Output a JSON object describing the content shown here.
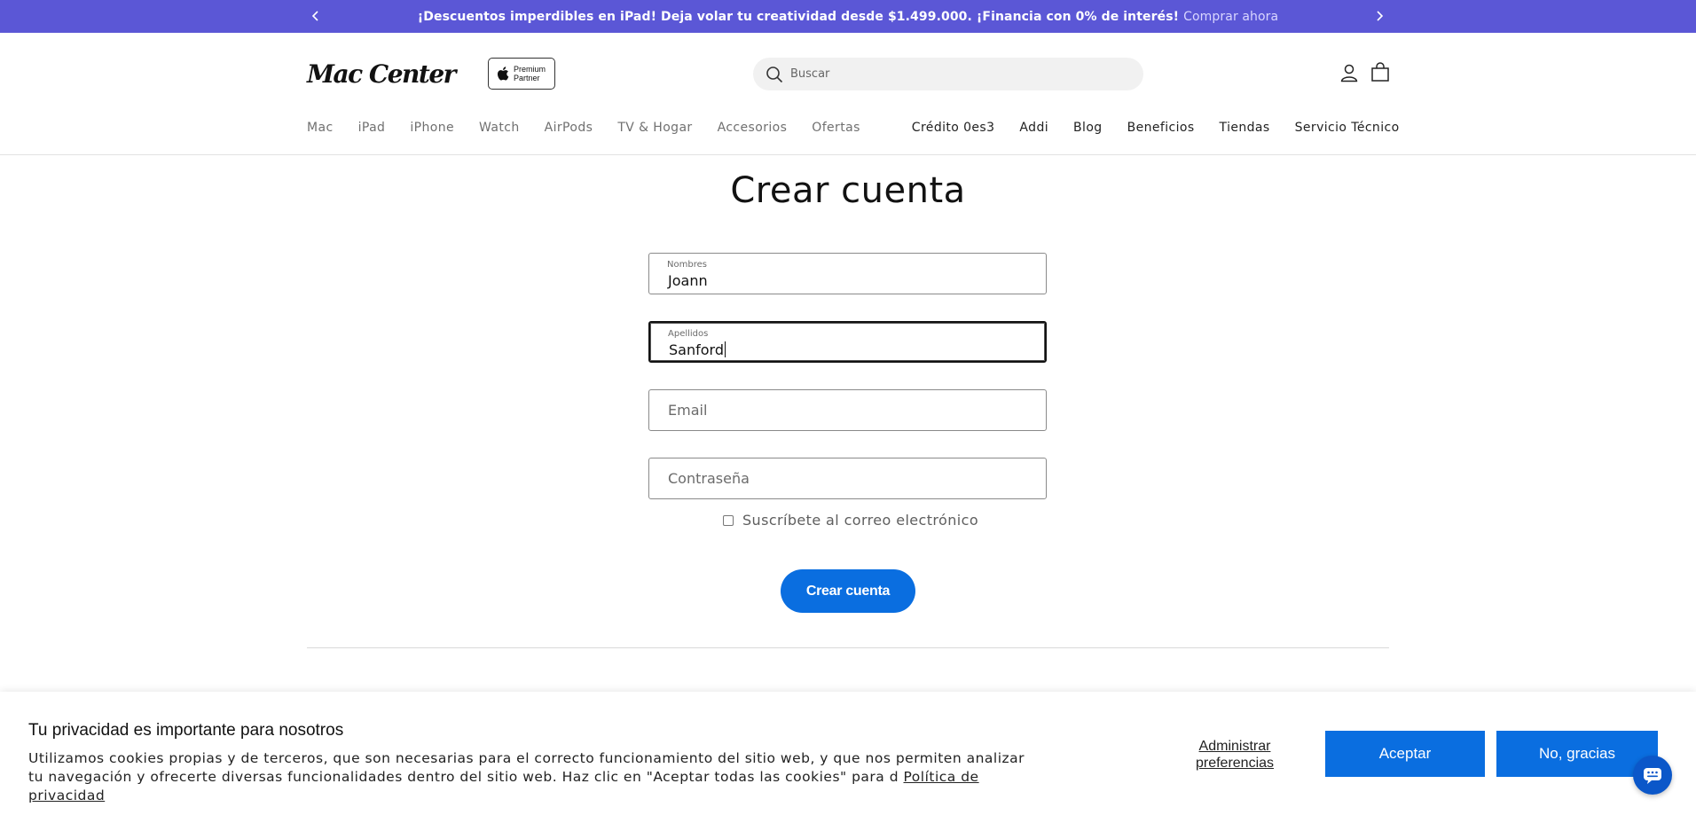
{
  "announcement": {
    "text": "¡Descuentos imperdibles en iPad! Deja volar tu creatividad desde $1.499.000. ¡Financia con 0% de interés!",
    "cta": "Comprar ahora"
  },
  "header": {
    "logo": "Mac Center",
    "badge_line1": "Premium",
    "badge_line2": "Partner",
    "search_placeholder": "Buscar"
  },
  "nav": {
    "primary": [
      "Mac",
      "iPad",
      "iPhone",
      "Watch",
      "AirPods",
      "TV & Hogar",
      "Accesorios",
      "Ofertas"
    ],
    "secondary": [
      "Crédito 0es3",
      "Addi",
      "Blog",
      "Beneficios",
      "Tiendas",
      "Servicio Técnico"
    ]
  },
  "form": {
    "title": "Crear cuenta",
    "first_name_label": "Nombres",
    "first_name_value": "Joann",
    "last_name_label": "Apellidos",
    "last_name_value": "Sanford",
    "email_placeholder": "Email",
    "password_placeholder": "Contraseña",
    "subscribe_label": "Suscríbete al correo electrónico",
    "submit_label": "Crear cuenta"
  },
  "cookie": {
    "title": "Tu privacidad es importante para nosotros",
    "text": "Utilizamos cookies propias y de terceros, que son necesarias para el correcto funcionamiento del sitio web, y que nos permiten analizar tu navegación y ofrecerte diversas funcionalidades dentro del sitio web. Haz clic en \"Aceptar todas las cookies\" para d",
    "policy_link": "Política de privacidad",
    "manage_line1": "Administrar",
    "manage_line2": "preferencias",
    "accept": "Aceptar",
    "decline": "No, gracias"
  },
  "colors": {
    "announcement_bg": "#5b57d6",
    "primary_button": "#0a6ee0",
    "chat_button": "#0b57c9"
  },
  "icons": [
    "chevron-left-icon",
    "chevron-right-icon",
    "apple-icon",
    "search-icon",
    "account-icon",
    "cart-icon",
    "chat-icon"
  ]
}
